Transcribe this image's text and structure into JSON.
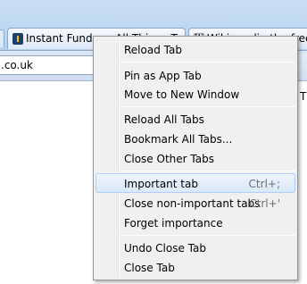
{
  "tabs": [
    {
      "title": "Instant Fundas - All Things Tech",
      "favicon": "instant-fundas-favicon"
    },
    {
      "title": "Wiki media the free en",
      "favicon": "wikipedia-favicon",
      "favicon_glyph": "W"
    }
  ],
  "url_bar": {
    "value": ".co.uk"
  },
  "page_content": {
    "partial_text": "T"
  },
  "context_menu": {
    "items": [
      {
        "label": "Reload Tab",
        "shortcut": ""
      },
      {
        "label": "Pin as App Tab",
        "shortcut": ""
      },
      {
        "label": "Move to New Window",
        "shortcut": ""
      },
      {
        "label": "Reload All Tabs",
        "shortcut": ""
      },
      {
        "label": "Bookmark All Tabs...",
        "shortcut": ""
      },
      {
        "label": "Close Other Tabs",
        "shortcut": ""
      },
      {
        "label": "Important tab",
        "shortcut": "Ctrl+;",
        "highlighted": true
      },
      {
        "label": "Close non-important tabs",
        "shortcut": "Ctrl+'"
      },
      {
        "label": "Forget importance",
        "shortcut": ""
      },
      {
        "label": "Undo Close Tab",
        "shortcut": ""
      },
      {
        "label": "Close Tab",
        "shortcut": ""
      }
    ]
  }
}
